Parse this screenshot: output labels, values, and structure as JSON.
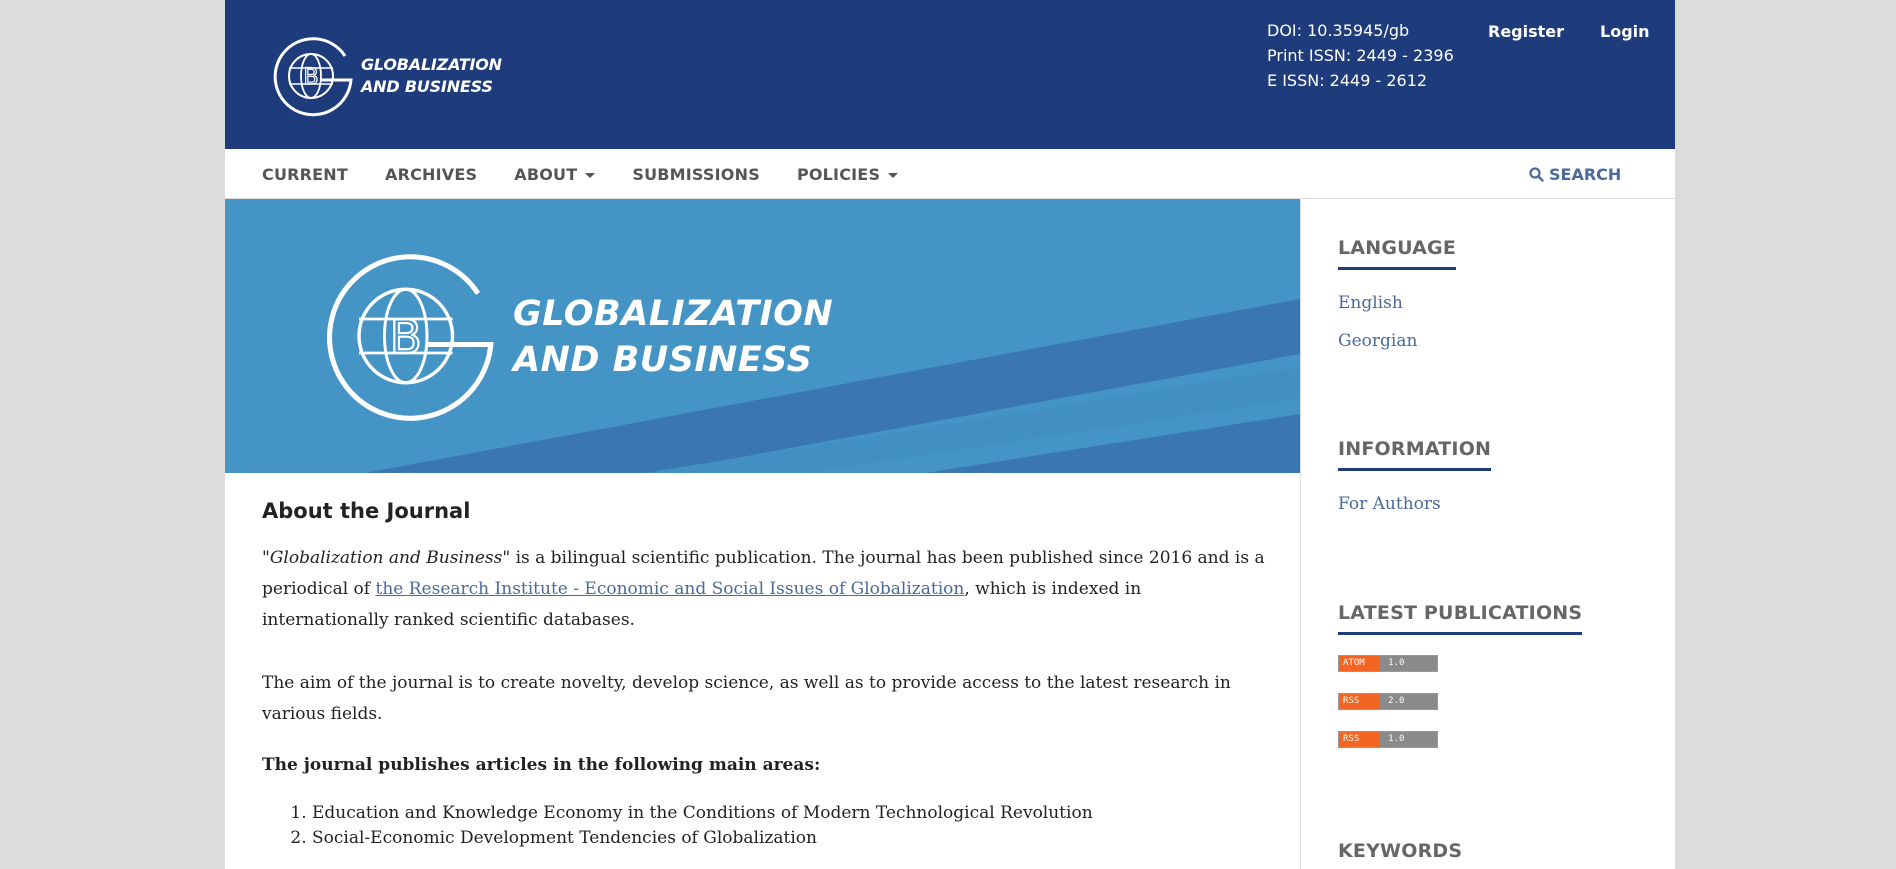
{
  "header": {
    "logo_line1": "GLOBALIZATION",
    "logo_line2": "AND BUSINESS",
    "doi": "DOI: 10.35945/gb",
    "print_issn": "Print ISSN: 2449 - 2396",
    "e_issn": "E ISSN: 2449 - 2612",
    "register": "Register",
    "login": "Login"
  },
  "nav": {
    "items": [
      {
        "label": "CURRENT"
      },
      {
        "label": "ARCHIVES"
      },
      {
        "label": "ABOUT"
      },
      {
        "label": "SUBMISSIONS"
      },
      {
        "label": "POLICIES"
      }
    ],
    "search": "SEARCH"
  },
  "banner": {
    "line1": "GLOBALIZATION",
    "line2": "AND BUSINESS"
  },
  "about": {
    "title": "About the Journal",
    "p1_italic": "\"Globalization and Business\"",
    "p1_a": " is a bilingual scientific publication. The journal has been published since 2016 and is a periodical of ",
    "p1_link": "the Research Institute - Economic and Social Issues of Globalization",
    "p1_b": ", which is indexed in internationally ranked scientific databases.",
    "p2": "The aim of the journal is to create novelty, develop science, as well as to provide access to the latest research in various fields.",
    "areas_heading": "The journal publishes articles in the following main areas:",
    "areas": [
      "Education and Knowledge Economy in the Conditions of Modern Technological Revolution",
      "Social-Economic Development Tendencies of Globalization"
    ]
  },
  "sidebar": {
    "language_title": "LANGUAGE",
    "languages": [
      "English",
      "Georgian"
    ],
    "information_title": "INFORMATION",
    "information_links": [
      "For Authors"
    ],
    "latest_title": "LATEST PUBLICATIONS",
    "feeds": [
      {
        "left": "ATOM",
        "right": "1.0"
      },
      {
        "left": "RSS",
        "right": "2.0"
      },
      {
        "left": "RSS",
        "right": "1.0"
      }
    ],
    "keywords_title": "KEYWORDS"
  },
  "colors": {
    "header_bg": "#1e3c7c",
    "banner_bg": "#4495c5",
    "link": "#4a6a9a"
  }
}
